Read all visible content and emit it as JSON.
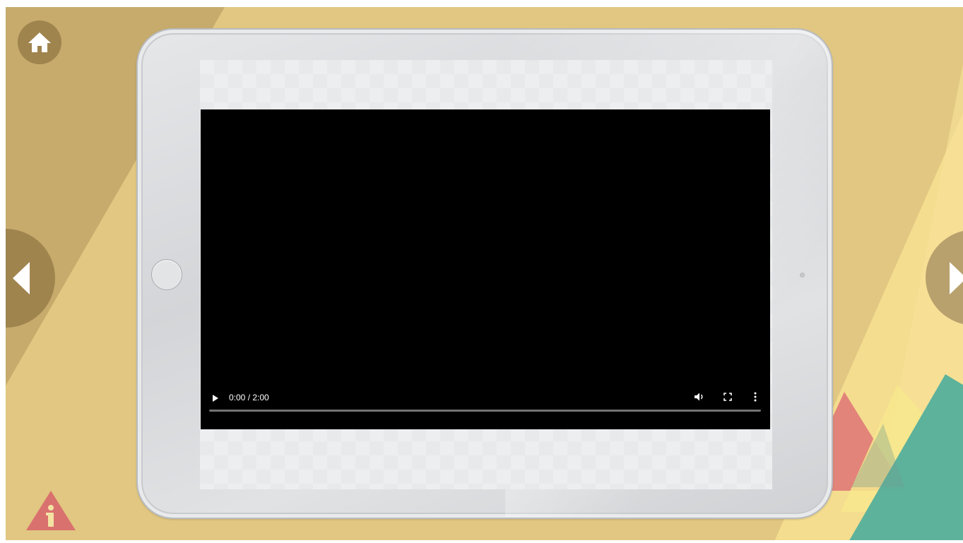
{
  "app": {
    "nav": {
      "home_icon": "home-icon",
      "prev_icon": "arrow-left-icon",
      "next_icon": "arrow-right-icon",
      "info_icon": "info-icon"
    },
    "video": {
      "time_label": "0:00 / 2:00",
      "progress_fraction": 0,
      "play_icon": "play-icon",
      "volume_icon": "volume-icon",
      "fullscreen_icon": "fullscreen-icon",
      "more_icon": "more-vertical-icon"
    },
    "colors": {
      "background_light": "#e1c781",
      "background_dark": "#c6ab6c",
      "nav_button": "#a0844e",
      "info_red": "#d9716e",
      "accent_teal": "#4fae9c",
      "accent_yellow": "#f5e389",
      "accent_pink": "#e07a78"
    }
  }
}
